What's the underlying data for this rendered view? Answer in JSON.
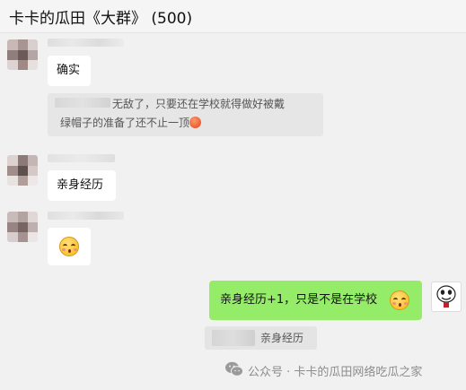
{
  "header": {
    "title": "卡卡的瓜田《大群》 (500)"
  },
  "messages": {
    "m1": {
      "text": "确实"
    },
    "quote": {
      "line1": "无敌了，只要还在学校就得做好被戴",
      "line2": "绿帽子的准备了还不止一顶"
    },
    "m2": {
      "text": "亲身经历"
    },
    "m3": {
      "emoji": "blush-emoji"
    },
    "m4": {
      "text": "亲身经历+1，只是不是在学校"
    },
    "m5": {
      "text": "亲身经历"
    }
  },
  "footer": {
    "text": "公众号 · 卡卡的瓜田网络吃瓜之家"
  },
  "colors": {
    "sent_bubble": "#95ec69",
    "received_bubble": "#ffffff",
    "background": "#f1f1f1"
  }
}
